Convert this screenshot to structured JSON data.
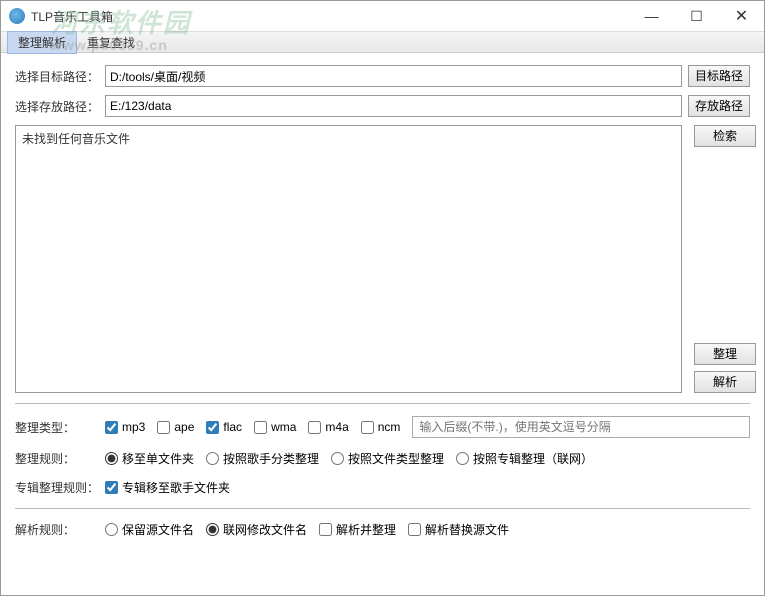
{
  "window": {
    "title": "TLP音乐工具箱"
  },
  "watermark": {
    "main": "河东软件园",
    "sub": "www.pc0359.cn"
  },
  "menu": {
    "item1": "整理解析",
    "item2": "重复查找"
  },
  "paths": {
    "target_label": "选择目标路径：",
    "target_value": "D:/tools/桌面/视频",
    "target_btn": "目标路径",
    "save_label": "选择存放路径：",
    "save_value": "E:/123/data",
    "save_btn": "存放路径"
  },
  "results": {
    "text": "未找到任何音乐文件",
    "search_btn": "检索",
    "organize_btn": "整理",
    "parse_btn": "解析"
  },
  "type": {
    "label": "整理类型：",
    "mp3": "mp3",
    "ape": "ape",
    "flac": "flac",
    "wma": "wma",
    "m4a": "m4a",
    "ncm": "ncm",
    "ext_placeholder": "输入后缀(不带.)，使用英文逗号分隔"
  },
  "rule": {
    "label": "整理规则：",
    "r1": "移至单文件夹",
    "r2": "按照歌手分类整理",
    "r3": "按照文件类型整理",
    "r4": "按照专辑整理（联网）"
  },
  "album_rule": {
    "label": "专辑整理规则：",
    "c1": "专辑移至歌手文件夹"
  },
  "parse_rule": {
    "label": "解析规则：",
    "r1": "保留源文件名",
    "r2": "联网修改文件名",
    "c1": "解析并整理",
    "c2": "解析替换源文件"
  }
}
